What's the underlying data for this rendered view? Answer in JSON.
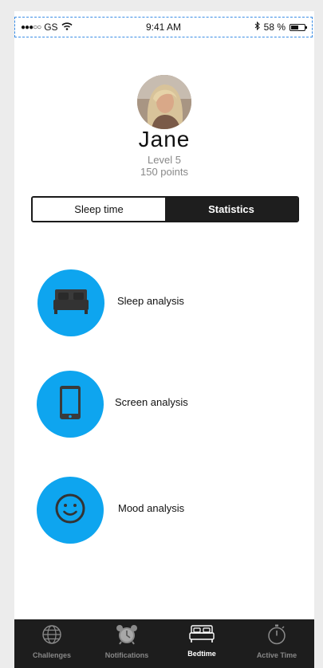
{
  "status_bar": {
    "signal_dots": "●●●○○",
    "carrier": "GS",
    "time": "9:41 AM",
    "battery_text": "58 %",
    "battery_level": 0.58
  },
  "profile": {
    "name": "Jane",
    "level": "Level 5",
    "points": "150 points"
  },
  "segmented": {
    "options": [
      "Sleep time",
      "Statistics"
    ],
    "selected": "Statistics"
  },
  "analysis": {
    "items": [
      {
        "label": "Sleep analysis",
        "icon": "bed-icon"
      },
      {
        "label": "Screen analysis",
        "icon": "phone-icon"
      },
      {
        "label": "Mood analysis",
        "icon": "smiley-icon"
      }
    ],
    "accent": "#0ea5ef"
  },
  "tab_bar": {
    "items": [
      {
        "label": "Challenges",
        "icon": "globe-icon"
      },
      {
        "label": "Notifications",
        "icon": "alarm-clock-icon"
      },
      {
        "label": "Bedtime",
        "icon": "bed-icon"
      },
      {
        "label": "Active Time",
        "icon": "stopwatch-icon"
      }
    ],
    "active": "Bedtime"
  }
}
